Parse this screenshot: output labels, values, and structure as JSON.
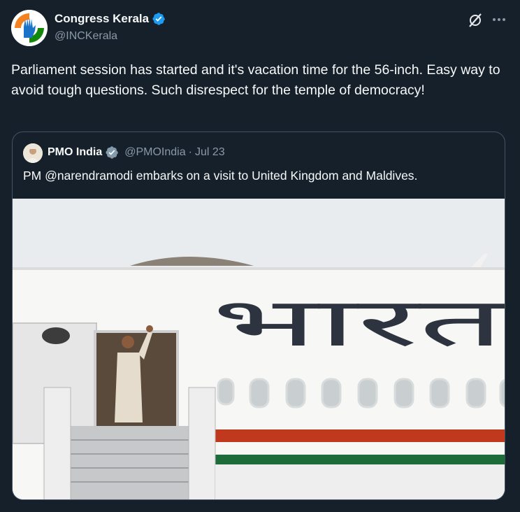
{
  "author": {
    "display_name": "Congress Kerala",
    "handle": "@INCKerala"
  },
  "tweet": {
    "text": "Parliament session has started and it's vacation time for the 56-inch. Easy way to avoid tough questions. Such disrespect for the temple of democracy!"
  },
  "quoted": {
    "display_name": "PMO India",
    "handle": "@PMOIndia",
    "separator": "·",
    "date": "Jul 23",
    "text": "PM @narendramodi embarks on a visit to United Kingdom and Maldives.",
    "image": {
      "aircraft_lettering": "भारत"
    }
  },
  "icons": {
    "verified": "verified-badge-icon",
    "grok": "grok-icon",
    "more": "more-icon"
  },
  "colors": {
    "background": "#15202b",
    "text_primary": "#f7f9f9",
    "text_secondary": "#8b98a5",
    "verified_blue": "#1d9bf0",
    "verified_gray": "#829aab",
    "border": "#425364"
  }
}
